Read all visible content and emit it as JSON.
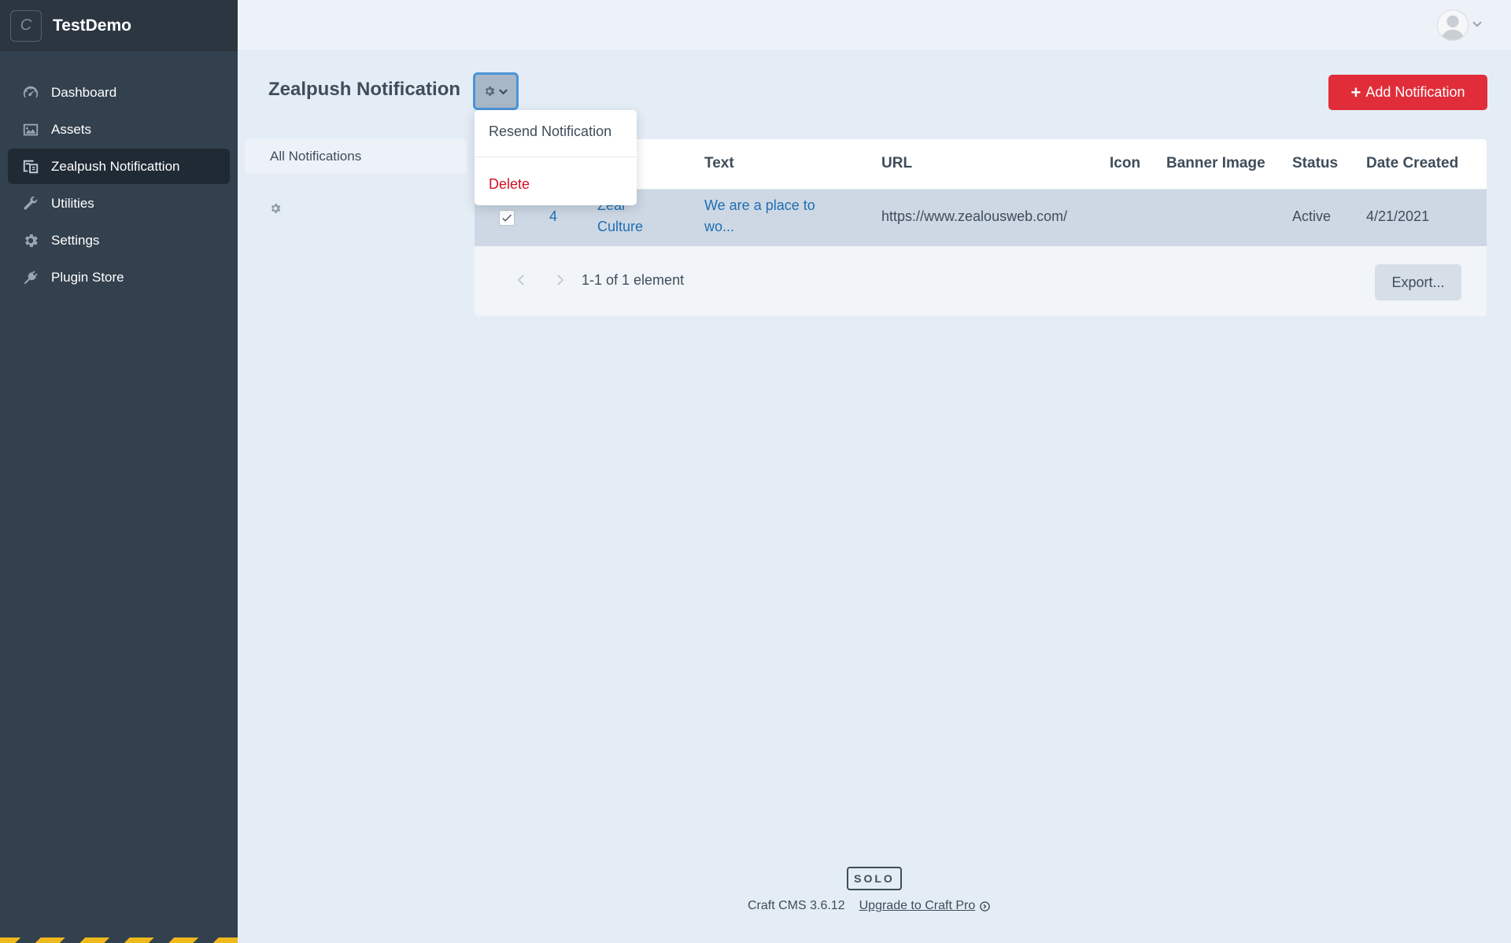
{
  "site": {
    "name": "TestDemo",
    "logo_letter": "C"
  },
  "sidebar": {
    "items": [
      {
        "label": "Dashboard",
        "icon": "gauge-icon"
      },
      {
        "label": "Assets",
        "icon": "image-icon"
      },
      {
        "label": "Zealpush Notificattion",
        "icon": "plugin-icon",
        "active": true
      },
      {
        "label": "Utilities",
        "icon": "wrench-icon"
      },
      {
        "label": "Settings",
        "icon": "gear-icon"
      },
      {
        "label": "Plugin Store",
        "icon": "plug-icon"
      }
    ]
  },
  "page": {
    "title": "Zealpush Notification",
    "add_button": "Add Notification",
    "add_icon": "+"
  },
  "sources": {
    "all": "All Notifications"
  },
  "actions_menu": {
    "resend": "Resend Notification",
    "delete": "Delete"
  },
  "table": {
    "columns": {
      "text": "Text",
      "url": "URL",
      "icon": "Icon",
      "banner": "Banner Image",
      "status": "Status",
      "date": "Date Created"
    },
    "rows": [
      {
        "id": "4",
        "title_line1": "Zeal",
        "title_line2": "Culture",
        "text_line1": "We are a place to",
        "text_line2": "wo...",
        "url": "https://www.zealousweb.com/",
        "status": "Active",
        "date": "4/21/2021"
      }
    ],
    "pagination": "1-1 of 1 element",
    "export": "Export..."
  },
  "footer": {
    "edition": "SOLO",
    "version": "Craft CMS 3.6.12",
    "upgrade": "Upgrade to Craft Pro"
  },
  "colors": {
    "sidebar": "#33404d",
    "accent_red": "#e12d39",
    "link_blue": "#1f6eb3",
    "danger": "#cf1124"
  }
}
